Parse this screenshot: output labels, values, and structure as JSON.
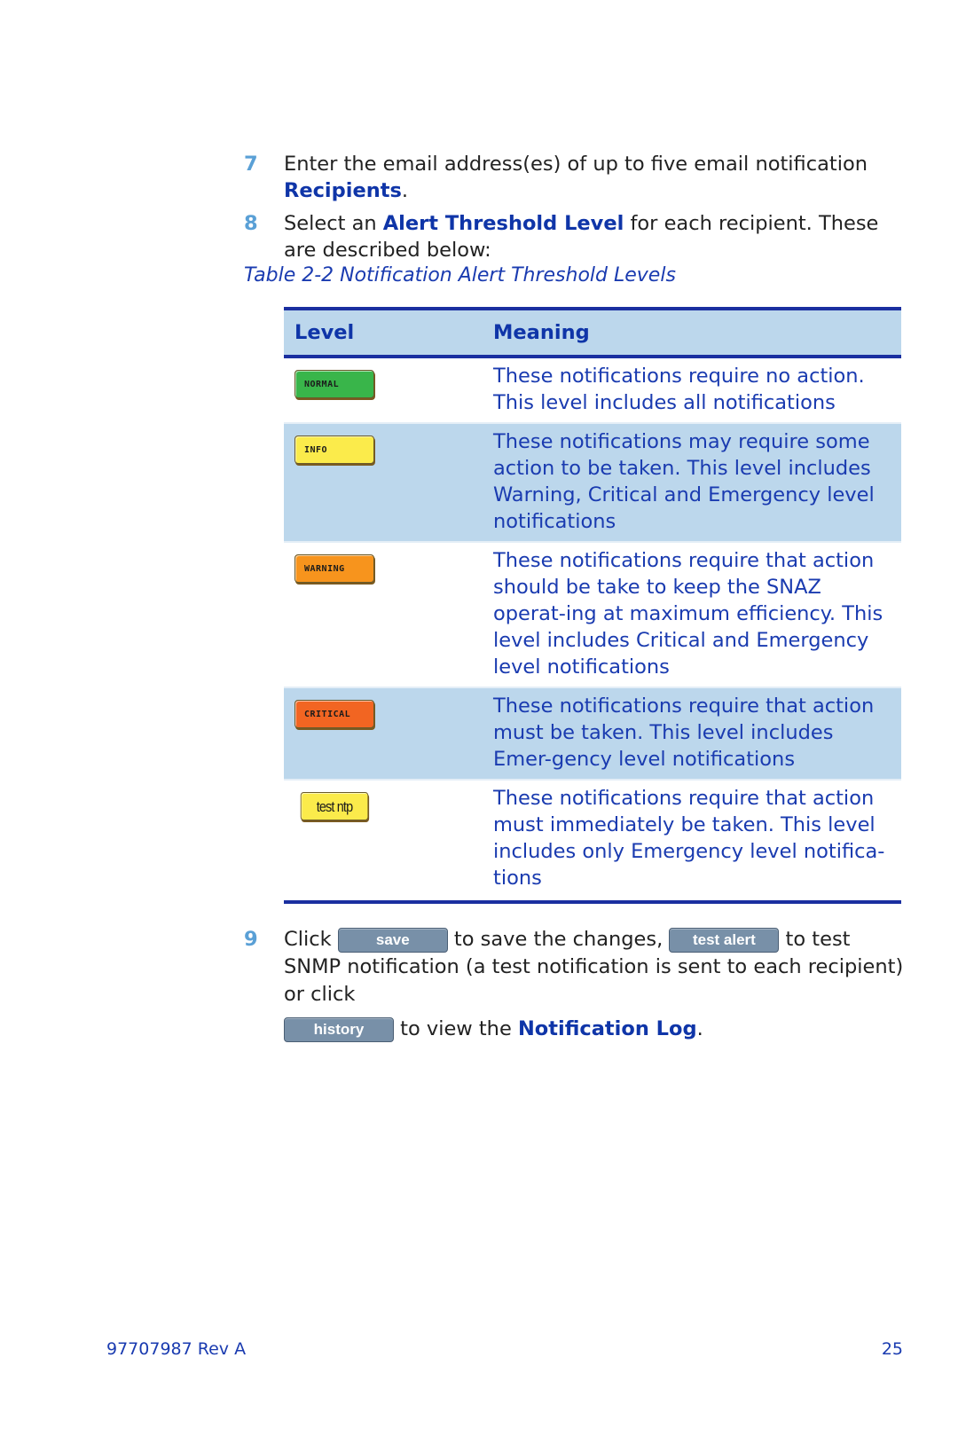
{
  "steps": [
    {
      "number": "7",
      "text_before": "Enter the email address(es) of up to five email notification ",
      "link": "Recipients",
      "text_after": "."
    },
    {
      "number": "8",
      "text_before": "Select an ",
      "link": "Alert Threshold Level",
      "text_after": " for each recipient. These are described below:"
    }
  ],
  "table": {
    "caption": "Table 2-2 Notification Alert Threshold Levels",
    "headers": [
      "Level",
      "Meaning"
    ],
    "rows": [
      {
        "badge": "NORMAL",
        "color": "#39b54a",
        "meaning": "These notifications require no action. This level includes all notifications"
      },
      {
        "badge": "INFO",
        "color": "#fbeb4b",
        "meaning": "These notifications may require some action to be taken. This level includes Warning, Critical and Emergency level notifications"
      },
      {
        "badge": "WARNING",
        "color": "#f7941d",
        "meaning": "These notifications require that action should be take to keep the SNAZ operat-ing at maximum efficiency. This level includes Critical and Emergency level notifications"
      },
      {
        "badge": "CRITICAL",
        "color": "#f26522",
        "meaning": "These notifications require that action must be taken. This level includes Emer-gency level notifications"
      },
      {
        "badge": "test ntp",
        "color": "#fbeb4b",
        "meaning": "These notifications require that action must immediately be taken. This level includes only Emergency level notifica-tions"
      }
    ]
  },
  "step9": {
    "number": "9",
    "click": "Click",
    "save_button": "save",
    "after_save": " to save the changes, ",
    "test_alert_button": "test alert",
    "after_test": " to test SNMP notification (a test notification is sent to each recipient) or click",
    "history_button": "history",
    "after_history": " to view the ",
    "link": "Notification Log",
    "end": "."
  },
  "footer": {
    "doc_id": "97707987 Rev A",
    "page_number": "25"
  }
}
